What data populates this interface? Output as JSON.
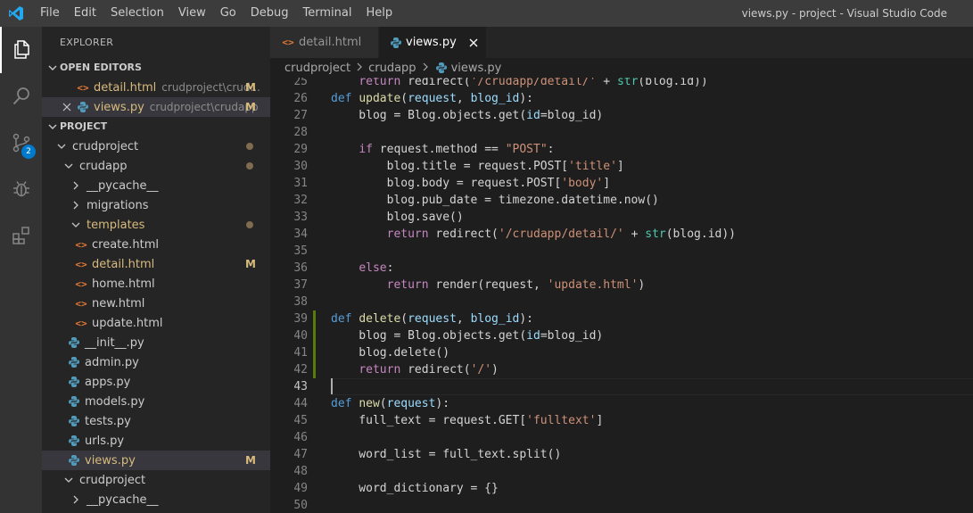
{
  "titlebar": {
    "menus": [
      "File",
      "Edit",
      "Selection",
      "View",
      "Go",
      "Debug",
      "Terminal",
      "Help"
    ],
    "window_title": "views.py - project - Visual Studio Code"
  },
  "activity_bar": [
    {
      "icon": "files-icon",
      "active": true
    },
    {
      "icon": "search-icon"
    },
    {
      "icon": "source-control-icon",
      "badge": "2"
    },
    {
      "icon": "debug-icon"
    },
    {
      "icon": "extensions-icon"
    }
  ],
  "sidebar": {
    "title": "EXPLORER",
    "open_editors": {
      "header": "OPEN EDITORS",
      "items": [
        {
          "name": "detail.html",
          "path": "crudproject\\crud...",
          "status": "M",
          "type": "html"
        },
        {
          "name": "views.py",
          "path": "crudproject\\crudapp",
          "status": "M",
          "type": "py"
        }
      ]
    },
    "project": {
      "header": "PROJECT",
      "tree": [
        {
          "name": "crudproject",
          "kind": "folder-open",
          "depth": 0,
          "dot": true
        },
        {
          "name": "crudapp",
          "kind": "folder-open",
          "depth": 1,
          "dot": true
        },
        {
          "name": "__pycache__",
          "kind": "folder-closed",
          "depth": 2
        },
        {
          "name": "migrations",
          "kind": "folder-closed",
          "depth": 2
        },
        {
          "name": "templates",
          "kind": "folder-open",
          "depth": 2,
          "dot": true,
          "modified": true
        },
        {
          "name": "create.html",
          "kind": "html",
          "depth": 3
        },
        {
          "name": "detail.html",
          "kind": "html",
          "depth": 3,
          "status": "M"
        },
        {
          "name": "home.html",
          "kind": "html",
          "depth": 3
        },
        {
          "name": "new.html",
          "kind": "html",
          "depth": 3
        },
        {
          "name": "update.html",
          "kind": "html",
          "depth": 3
        },
        {
          "name": "__init__.py",
          "kind": "py",
          "depth": 2
        },
        {
          "name": "admin.py",
          "kind": "py",
          "depth": 2
        },
        {
          "name": "apps.py",
          "kind": "py",
          "depth": 2
        },
        {
          "name": "models.py",
          "kind": "py",
          "depth": 2
        },
        {
          "name": "tests.py",
          "kind": "py",
          "depth": 2
        },
        {
          "name": "urls.py",
          "kind": "py",
          "depth": 2
        },
        {
          "name": "views.py",
          "kind": "py",
          "depth": 2,
          "status": "M",
          "selected": true
        },
        {
          "name": "crudproject",
          "kind": "folder-open",
          "depth": 1
        },
        {
          "name": "__pycache__",
          "kind": "folder-closed",
          "depth": 2
        }
      ]
    }
  },
  "tabs": [
    {
      "label": "detail.html",
      "type": "html",
      "active": false
    },
    {
      "label": "views.py",
      "type": "py",
      "active": true
    }
  ],
  "breadcrumb": [
    "crudproject",
    "crudapp",
    "views.py"
  ],
  "editor": {
    "current_line": 43,
    "modified_lines": [
      39,
      40,
      41,
      42
    ],
    "lines": [
      {
        "n": "25",
        "tokens": [
          [
            "o",
            "    "
          ],
          [
            "c",
            "return"
          ],
          [
            "o",
            " redirect("
          ],
          [
            "s",
            "'/crudapp/detail/'"
          ],
          [
            "o",
            " + "
          ],
          [
            "t",
            "str"
          ],
          [
            "o",
            "(blog.id))"
          ]
        ]
      },
      {
        "n": "26",
        "tokens": [
          [
            "k",
            "def"
          ],
          [
            "o",
            " "
          ],
          [
            "f",
            "update"
          ],
          [
            "o",
            "("
          ],
          [
            "p",
            "request"
          ],
          [
            "o",
            ", "
          ],
          [
            "p",
            "blog_id"
          ],
          [
            "o",
            "):"
          ]
        ]
      },
      {
        "n": "27",
        "tokens": [
          [
            "o",
            "    blog = Blog.objects.get("
          ],
          [
            "p",
            "id"
          ],
          [
            "o",
            "=blog_id)"
          ]
        ]
      },
      {
        "n": "28",
        "tokens": []
      },
      {
        "n": "29",
        "tokens": [
          [
            "o",
            "    "
          ],
          [
            "c",
            "if"
          ],
          [
            "o",
            " request.method == "
          ],
          [
            "s",
            "\"POST\""
          ],
          [
            "o",
            ":"
          ]
        ]
      },
      {
        "n": "30",
        "tokens": [
          [
            "o",
            "        blog.title = request.POST["
          ],
          [
            "s",
            "'title'"
          ],
          [
            "o",
            "]"
          ]
        ]
      },
      {
        "n": "31",
        "tokens": [
          [
            "o",
            "        blog.body = request.POST["
          ],
          [
            "s",
            "'body'"
          ],
          [
            "o",
            "]"
          ]
        ]
      },
      {
        "n": "32",
        "tokens": [
          [
            "o",
            "        blog.pub_date = timezone.datetime.now()"
          ]
        ]
      },
      {
        "n": "33",
        "tokens": [
          [
            "o",
            "        blog.save()"
          ]
        ]
      },
      {
        "n": "34",
        "tokens": [
          [
            "o",
            "        "
          ],
          [
            "c",
            "return"
          ],
          [
            "o",
            " redirect("
          ],
          [
            "s",
            "'/crudapp/detail/'"
          ],
          [
            "o",
            " + "
          ],
          [
            "t",
            "str"
          ],
          [
            "o",
            "(blog.id))"
          ]
        ]
      },
      {
        "n": "35",
        "tokens": []
      },
      {
        "n": "36",
        "tokens": [
          [
            "o",
            "    "
          ],
          [
            "c",
            "else"
          ],
          [
            "o",
            ":"
          ]
        ]
      },
      {
        "n": "37",
        "tokens": [
          [
            "o",
            "        "
          ],
          [
            "c",
            "return"
          ],
          [
            "o",
            " render(request, "
          ],
          [
            "s",
            "'update.html'"
          ],
          [
            "o",
            ")"
          ]
        ]
      },
      {
        "n": "38",
        "tokens": []
      },
      {
        "n": "39",
        "tokens": [
          [
            "k",
            "def"
          ],
          [
            "o",
            " "
          ],
          [
            "f",
            "delete"
          ],
          [
            "o",
            "("
          ],
          [
            "p",
            "request"
          ],
          [
            "o",
            ", "
          ],
          [
            "p",
            "blog_id"
          ],
          [
            "o",
            "):"
          ]
        ]
      },
      {
        "n": "40",
        "tokens": [
          [
            "o",
            "    blog = Blog.objects.get("
          ],
          [
            "p",
            "id"
          ],
          [
            "o",
            "=blog_id)"
          ]
        ]
      },
      {
        "n": "41",
        "tokens": [
          [
            "o",
            "    blog.delete()"
          ]
        ]
      },
      {
        "n": "42",
        "tokens": [
          [
            "o",
            "    "
          ],
          [
            "c",
            "return"
          ],
          [
            "o",
            " redirect("
          ],
          [
            "s",
            "'/'"
          ],
          [
            "o",
            ")"
          ]
        ]
      },
      {
        "n": "43",
        "tokens": []
      },
      {
        "n": "44",
        "tokens": [
          [
            "k",
            "def"
          ],
          [
            "o",
            " "
          ],
          [
            "f",
            "new"
          ],
          [
            "o",
            "("
          ],
          [
            "p",
            "request"
          ],
          [
            "o",
            "):"
          ]
        ]
      },
      {
        "n": "45",
        "tokens": [
          [
            "o",
            "    full_text = request.GET["
          ],
          [
            "s",
            "'fulltext'"
          ],
          [
            "o",
            "]"
          ]
        ]
      },
      {
        "n": "46",
        "tokens": []
      },
      {
        "n": "47",
        "tokens": [
          [
            "o",
            "    word_list = full_text.split()"
          ]
        ]
      },
      {
        "n": "48",
        "tokens": []
      },
      {
        "n": "49",
        "tokens": [
          [
            "o",
            "    word_dictionary = {}"
          ]
        ]
      },
      {
        "n": "50",
        "tokens": []
      }
    ]
  },
  "colors": {
    "accent": "#007acc",
    "modified": "#d7ba7d",
    "gutter_added": "#587c0c",
    "python_icon": "#519aba",
    "html_icon": "#e37933"
  }
}
